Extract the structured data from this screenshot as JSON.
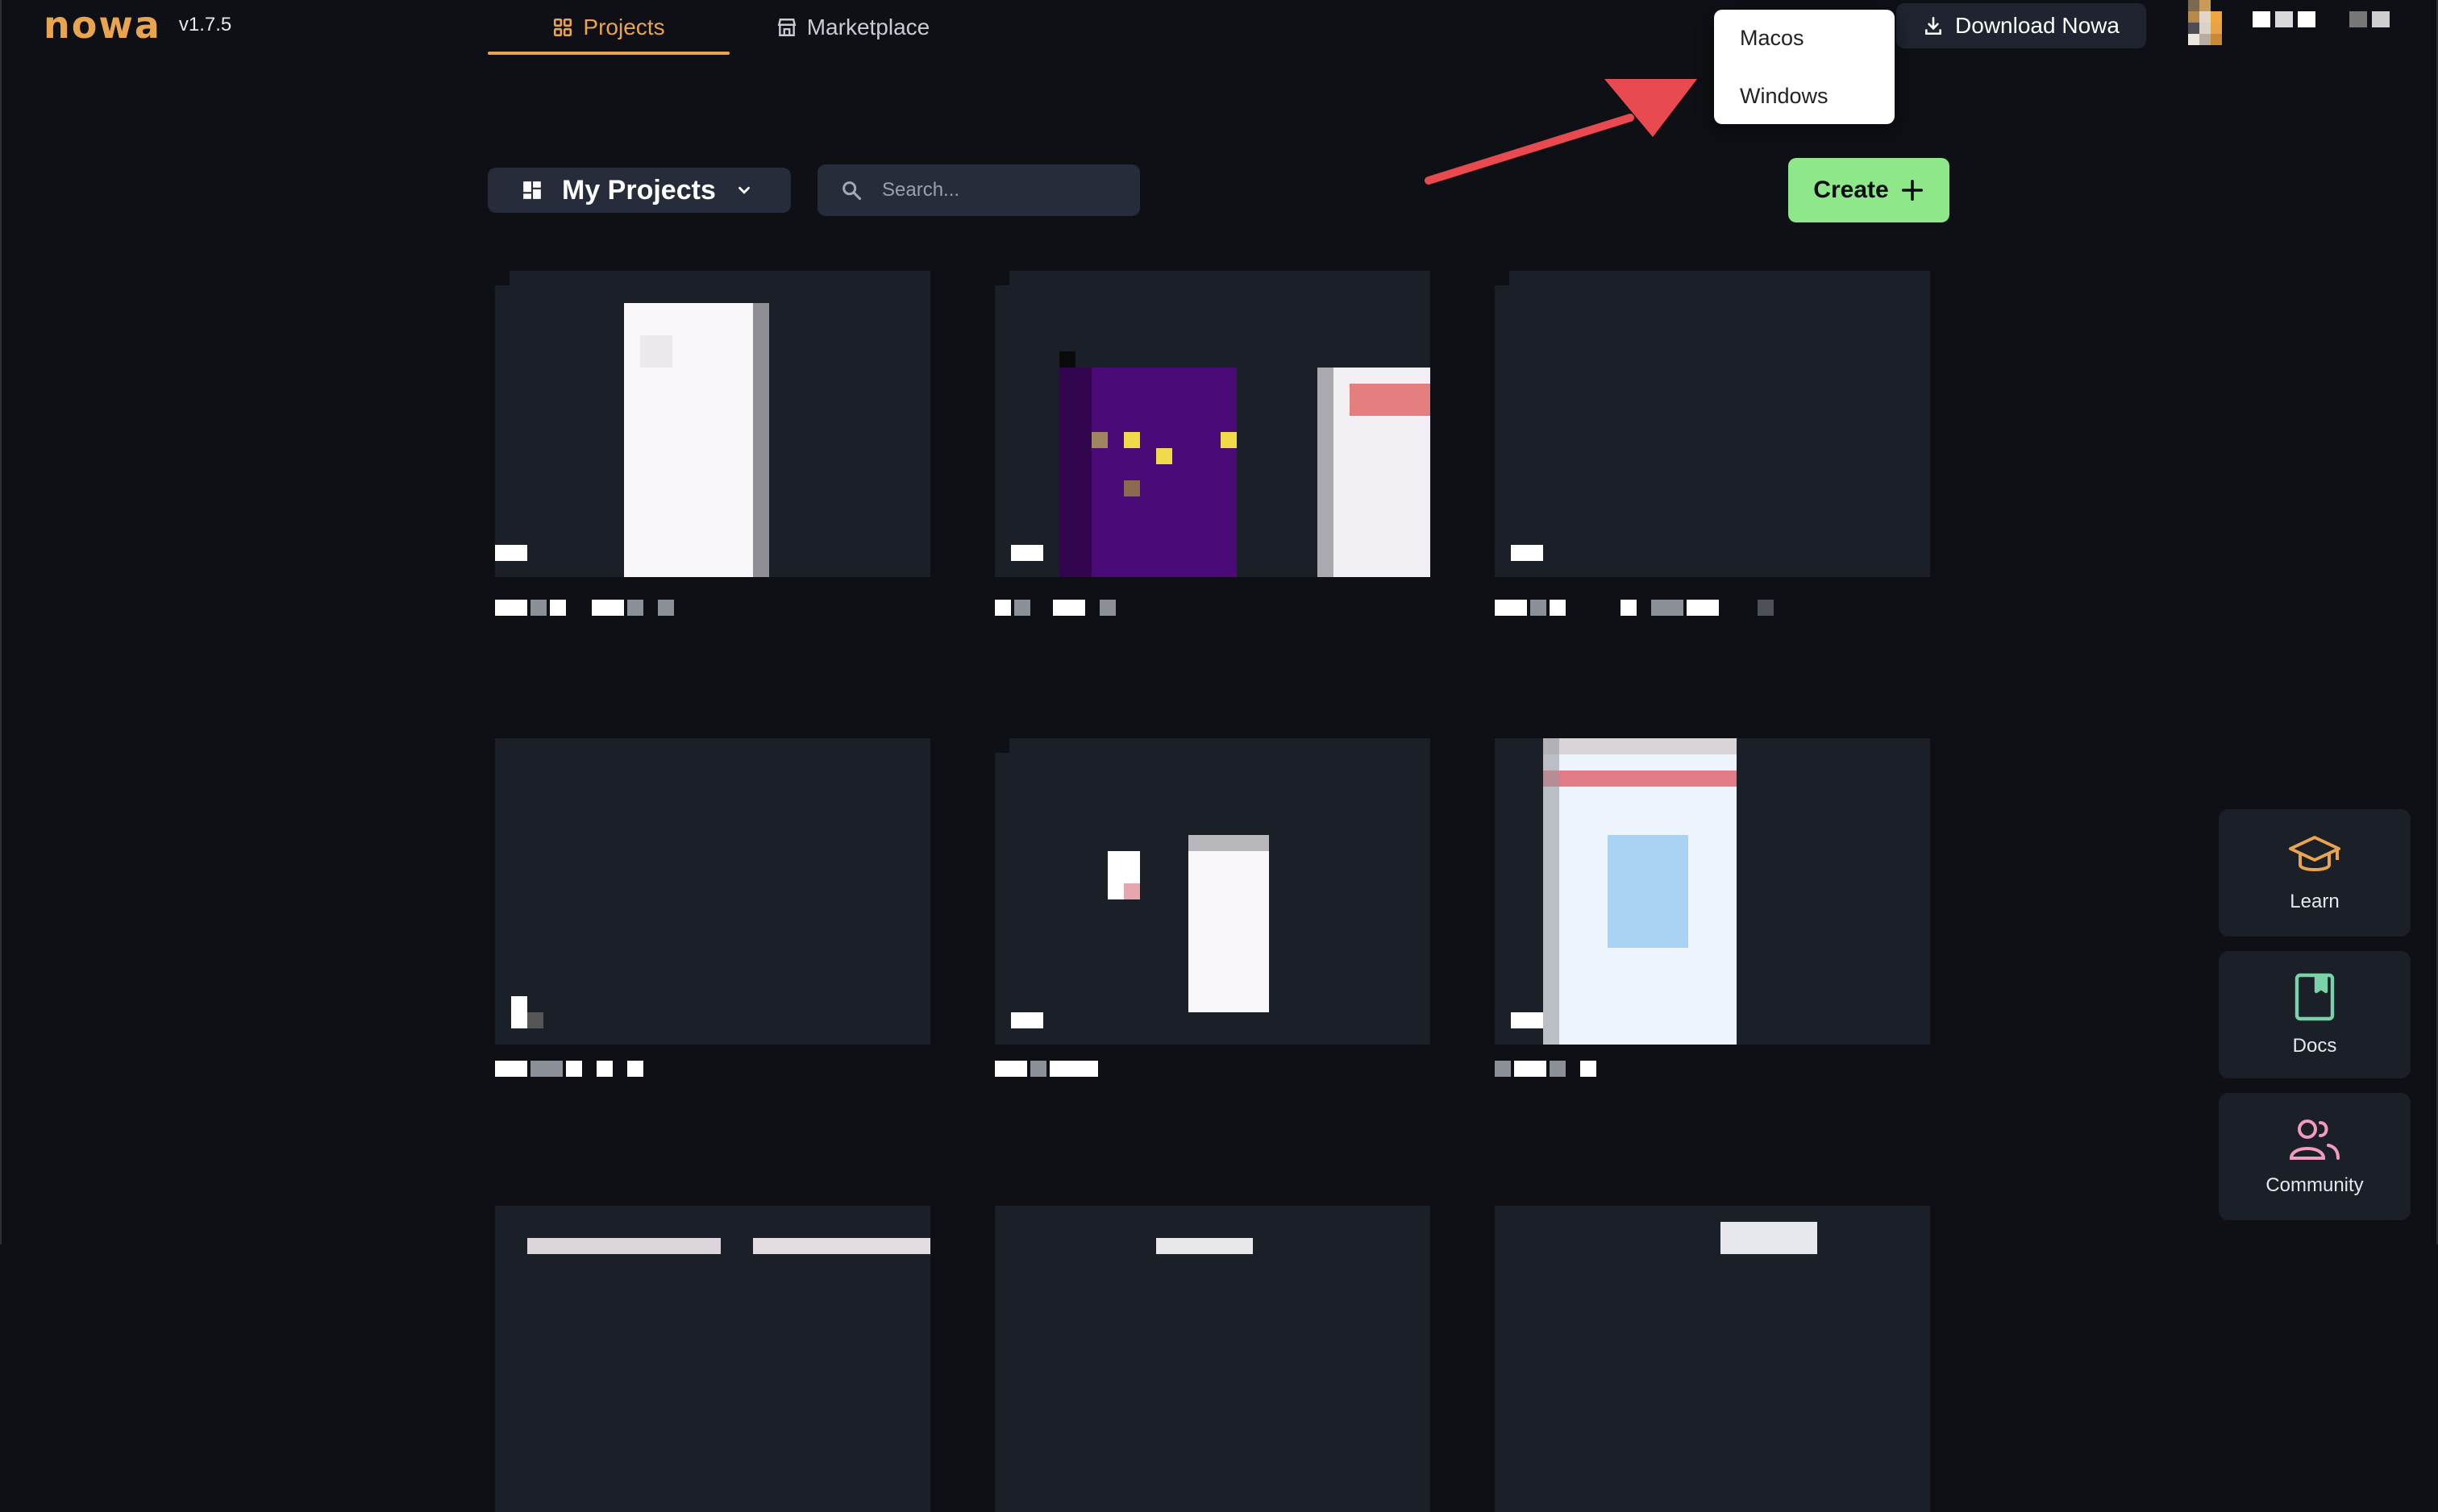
{
  "app": {
    "logo_text": "nowa",
    "version": "v1.7.5"
  },
  "nav": {
    "tabs": [
      {
        "label": "Projects",
        "icon": "grid-icon",
        "active": true
      },
      {
        "label": "Marketplace",
        "icon": "store-icon",
        "active": false
      }
    ]
  },
  "header": {
    "download_label": "Download Nowa"
  },
  "download_menu": {
    "items": [
      "Macos",
      "Windows"
    ]
  },
  "toolbar": {
    "projects_label": "My Projects",
    "search_placeholder": "Search...",
    "create_label": "Create"
  },
  "side_panel": {
    "learn": "Learn",
    "docs": "Docs",
    "community": "Community"
  },
  "colors": {
    "accent": "#e9a44f",
    "create_green": "#8ee88a",
    "background": "#0e1015",
    "card": "#1b1f28",
    "arrow": "#e84a4f"
  }
}
